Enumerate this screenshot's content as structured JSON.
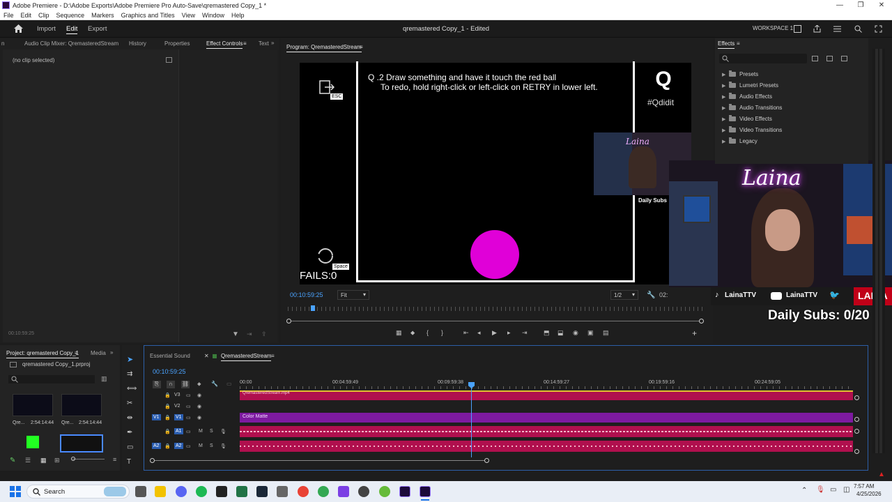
{
  "titlebar": {
    "title": "Adobe Premiere - D:\\Adobe Exports\\Adobe Premiere Pro Auto-Save\\qremastered Copy_1 *",
    "controls": [
      "—",
      "❐",
      "✕"
    ]
  },
  "menu": [
    "File",
    "Edit",
    "Clip",
    "Sequence",
    "Markers",
    "Graphics and Titles",
    "View",
    "Window",
    "Help"
  ],
  "header": {
    "tabs": [
      "Import",
      "Edit",
      "Export"
    ],
    "active_tab": "Edit",
    "doc_title": "qremastered Copy_1 - Edited",
    "workspace": "WORKSPACE 1"
  },
  "source_panel": {
    "tabs": [
      "n",
      "Audio Clip Mixer: QremasteredStream",
      "History",
      "Properties",
      "Effect Controls",
      "Text"
    ],
    "active_tab": "Effect Controls",
    "no_clip": "(no clip selected)",
    "timecode": "00:10:59:25"
  },
  "program_monitor": {
    "title": "Program: QremasteredStream",
    "timecode": "00:10:59:25",
    "fit": "Fit",
    "resolution": "1/2",
    "duration_partial": "02:",
    "game_text_line1": "Q  .2 Draw something and have it touch the red ball",
    "game_text_line2": "To redo, hold right-click or left-click on RETRY in lower left.",
    "esc_label": "ESC",
    "space_label": "Space",
    "fails": "FAILS:0",
    "hashtag": "#Qdidit",
    "daily_subs_small": "Daily Subs",
    "laina_small": "Laina",
    "overlay_name": "Laina",
    "socials": [
      "LainaTTV",
      "LainaTTV"
    ],
    "brand": "LAINA",
    "daily_subs_big": "Daily Subs: 0/20",
    "ball_color": "#e000d8"
  },
  "effects_panel": {
    "title": "Effects",
    "items": [
      "Presets",
      "Lumetri Presets",
      "Audio Effects",
      "Audio Transitions",
      "Video Effects",
      "Video Transitions",
      "Legacy"
    ]
  },
  "project_panel": {
    "tabs": [
      "Project: qremastered Copy_1",
      "Media"
    ],
    "project_file": "qremastered Copy_1.prproj",
    "thumbs": [
      {
        "name": "Qre...",
        "duration": "2:54:14:44"
      },
      {
        "name": "Qre...",
        "duration": "2:54:14:44"
      }
    ]
  },
  "timeline": {
    "tabs": [
      "Essential Sound",
      "QremasteredStream"
    ],
    "active_tab": "QremasteredStream",
    "timecode": "00:10:59:25",
    "ruler": [
      "00:00",
      "00:04:59:49",
      "00:09:59:38",
      "00:14:59:27",
      "00:19:59:16",
      "00:24:59:05"
    ],
    "tracks": [
      "V3",
      "V2",
      "V1",
      "A1",
      "A2"
    ],
    "source_tracks": [
      "V1",
      "A1",
      "A2"
    ],
    "v3_clip": "QremasteredStream.mp4",
    "v1_clip": "Color Matte",
    "audio_marks": [
      "M",
      "S"
    ]
  },
  "taskbar": {
    "search": "Search",
    "time": "7:57 AM",
    "date": "4/25/2026"
  }
}
